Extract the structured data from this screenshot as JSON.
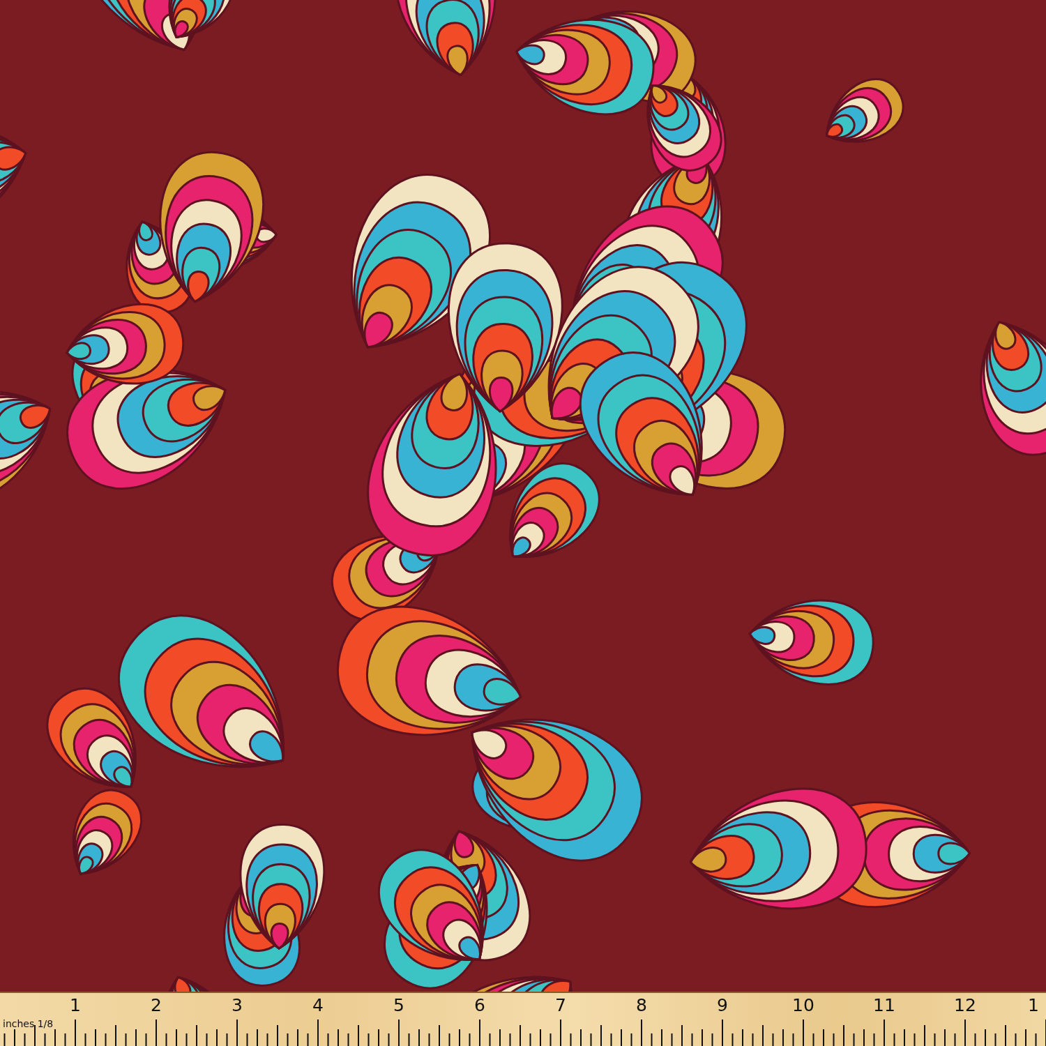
{
  "ruler": {
    "unit_label": "inches 1/8",
    "numbers": [
      "1",
      "2",
      "3",
      "4",
      "5",
      "6",
      "7",
      "8",
      "9",
      "10",
      "11",
      "12",
      "1"
    ]
  }
}
